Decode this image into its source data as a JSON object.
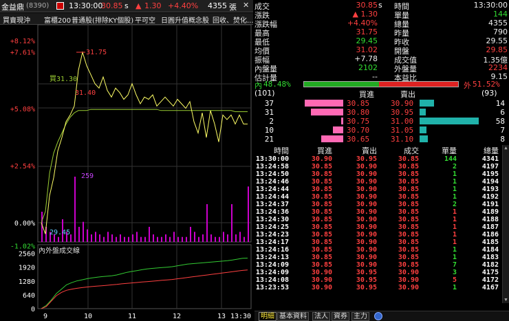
{
  "header": {
    "stock_name": "金益鼎",
    "stock_code": "(8390)",
    "time": "13:30:00",
    "price": "30.85",
    "price_suffix": "s",
    "change": "1.30",
    "change_pct": "+4.40%",
    "volume": "4355",
    "volume_unit": "張",
    "icons": [
      "calendar-icon",
      "up-triangle-icon",
      "close-icon"
    ]
  },
  "subheader": {
    "items": [
      "買賣現沖",
      "富櫃200",
      "普通股(排除KY個股)",
      "平可空",
      "日圓升值概念股",
      "回收、焚化..."
    ]
  },
  "chart_data": {
    "type": "line",
    "y_ticks": [
      "+8.12%",
      "+7.61%",
      "+5.08%",
      "+2.54%",
      "0.00%",
      "-1.02%"
    ],
    "annotations": [
      {
        "text": "31.75",
        "x": 9.98,
        "y": 31.75
      },
      {
        "text": "買31.30",
        "x": 9.8,
        "y": 31.3
      },
      {
        "text": "31.40",
        "x": 9.75,
        "y": 31.4
      },
      {
        "text": "259",
        "x": 9.75,
        "y": 259
      },
      {
        "text": "29.45",
        "x": 9.05,
        "y": 29.45
      }
    ],
    "lower_panel_title": "內外盤成交線",
    "lower_y_ticks": [
      "2560",
      "1920",
      "1280",
      "640",
      "0"
    ],
    "x_ticks": [
      "9",
      "10",
      "11",
      "12",
      "13",
      "13:30"
    ],
    "series": [
      {
        "values_pct": [
          0.0,
          -0.5,
          1.2,
          2.0,
          3.2,
          3.8,
          4.5,
          4.8,
          5.2,
          6.8,
          7.6,
          7.0,
          6.6,
          6.2,
          6.0,
          6.5,
          5.9,
          5.6,
          6.0,
          5.8,
          5.5,
          5.7,
          6.2,
          5.7,
          5.3,
          5.6,
          5.5,
          5.7,
          5.2,
          5.4,
          5.6,
          5.4,
          5.2,
          5.5,
          5.3,
          5.1,
          5.4,
          4.5,
          4.0,
          4.9,
          3.8,
          5.0,
          4.4,
          3.6,
          4.8,
          4.6,
          4.8,
          4.4,
          4.8,
          4.4,
          4.4
        ]
      },
      {
        "values_pct": [
          0.0,
          0.5,
          2.2,
          3.1,
          3.6,
          4.0,
          4.4,
          4.7,
          4.9,
          5.0,
          5.0,
          5.0,
          5.05,
          5.05,
          5.05,
          5.05,
          5.05,
          5.05,
          5.05,
          5.05,
          5.05,
          5.05,
          5.05,
          5.05,
          5.05,
          5.05,
          5.05,
          5.05,
          5.05,
          5.0,
          5.0,
          5.0,
          5.0,
          5.0,
          5.0,
          5.0,
          5.0,
          5.0,
          5.0,
          5.0,
          5.0,
          5.0,
          5.0,
          5.0,
          5.0,
          5.0,
          5.0,
          4.95,
          4.95,
          4.95,
          4.95
        ]
      },
      {
        "values": [
          120,
          60,
          40,
          30,
          20,
          90,
          40,
          30,
          259,
          60,
          80,
          50,
          30,
          40,
          30,
          20,
          40,
          30,
          20,
          30,
          20,
          20,
          30,
          40,
          20,
          20,
          60,
          30,
          20,
          20,
          30,
          20,
          40,
          20,
          20,
          20,
          60,
          40,
          20,
          30,
          150,
          30,
          20,
          20,
          40,
          30,
          150,
          30,
          40,
          20,
          220
        ]
      },
      {
        "name": "內盤",
        "values": [
          0,
          150,
          400,
          700,
          900,
          1100,
          1200,
          1280,
          1330,
          1380,
          1420,
          1450,
          1480,
          1500,
          1520,
          1560,
          1620,
          1680,
          1720,
          1760,
          1800,
          1840,
          1860,
          1880,
          1900,
          1920,
          1940,
          1980,
          2020,
          2060,
          2080,
          2100,
          2120,
          2140,
          2160,
          2180,
          2200,
          2220,
          2250,
          2290,
          2330,
          2340
        ]
      },
      {
        "name": "外盤",
        "values": [
          0,
          100,
          350,
          600,
          750,
          850,
          900,
          940,
          970,
          1000,
          1020,
          1040,
          1060,
          1080,
          1100,
          1120,
          1150,
          1170,
          1190,
          1210,
          1230,
          1250,
          1270,
          1290,
          1310,
          1330,
          1350,
          1380,
          1410,
          1440,
          1470,
          1500,
          1530,
          1560,
          1590,
          1620,
          1650,
          1680,
          1710,
          1740,
          1770,
          1790
        ]
      }
    ]
  },
  "quote": {
    "rows": [
      {
        "l1": "成交",
        "v1": "30.85",
        "v1s": "s",
        "c1": "red",
        "l2": "時間",
        "v2": "13:30:00",
        "c2": "wht"
      },
      {
        "l1": "漲跌",
        "v1": "▲ 1.30",
        "v1s": "",
        "c1": "red",
        "l2": "單量",
        "v2": "144",
        "c2": "grn"
      },
      {
        "l1": "漲跌幅",
        "v1": "+4.40%",
        "v1s": "",
        "c1": "red",
        "l2": "總量",
        "v2": "4355",
        "c2": "wht"
      },
      {
        "l1": "最高",
        "v1": "31.75",
        "v1s": "",
        "c1": "red",
        "l2": "昨量",
        "v2": "790",
        "c2": "wht"
      },
      {
        "l1": "最低",
        "v1": "29.45",
        "v1s": "",
        "c1": "grn",
        "l2": "昨收",
        "v2": "29.55",
        "c2": "wht"
      },
      {
        "l1": "均價",
        "v1": "31.02",
        "v1s": "",
        "c1": "red",
        "l2": "開盤",
        "v2": "29.85",
        "c2": "red"
      },
      {
        "l1": "振幅",
        "v1": "+7.78",
        "v1s": "",
        "c1": "wht",
        "l2": "成交值",
        "v2": "1.35億",
        "c2": "wht"
      },
      {
        "l1": "內盤量",
        "v1": "2102",
        "v1s": "",
        "c1": "grn",
        "l2": "外盤量",
        "v2": "2234",
        "c2": "red"
      },
      {
        "l1": "估計量",
        "v1": "--",
        "v1s": "",
        "c1": "wht",
        "l2": "本益比",
        "v2": "9.15",
        "c2": "wht"
      }
    ]
  },
  "ratio": {
    "inner_label": "內",
    "inner_pct": "48.48%",
    "outer_label": "外",
    "outer_pct": "51.52%",
    "inner_fraction": 0.4848
  },
  "orderbook": {
    "bid_total": "(101)",
    "ask_total": "(93)",
    "bid_header": "買進",
    "ask_header": "賣出",
    "rows": [
      {
        "bid_qty": "37",
        "bid_px": "30.85",
        "ask_px": "30.90",
        "ask_qty": "14",
        "bid_ratio": 1.0,
        "ask_ratio": 0.24
      },
      {
        "bid_qty": "31",
        "bid_px": "30.80",
        "ask_px": "30.95",
        "ask_qty": "6",
        "bid_ratio": 0.84,
        "ask_ratio": 0.1
      },
      {
        "bid_qty": "2",
        "bid_px": "30.75",
        "ask_px": "31.00",
        "ask_qty": "58",
        "bid_ratio": 0.06,
        "ask_ratio": 1.0
      },
      {
        "bid_qty": "10",
        "bid_px": "30.70",
        "ask_px": "31.05",
        "ask_qty": "7",
        "bid_ratio": 0.27,
        "ask_ratio": 0.12
      },
      {
        "bid_qty": "21",
        "bid_px": "30.65",
        "ask_px": "31.10",
        "ask_qty": "8",
        "bid_ratio": 0.57,
        "ask_ratio": 0.14
      }
    ]
  },
  "ticks": {
    "headers": [
      "時間",
      "買進",
      "賣出",
      "成交",
      "單量",
      "總量"
    ],
    "rows": [
      [
        "13:30:00",
        "30.90",
        "30.95",
        "30.85",
        "144",
        "4341"
      ],
      [
        "13:24:58",
        "30.85",
        "30.90",
        "30.85",
        "2",
        "4197"
      ],
      [
        "13:24:50",
        "30.85",
        "30.90",
        "30.85",
        "1",
        "4195"
      ],
      [
        "13:24:46",
        "30.85",
        "30.90",
        "30.85",
        "1",
        "4194"
      ],
      [
        "13:24:44",
        "30.85",
        "30.90",
        "30.85",
        "1",
        "4193"
      ],
      [
        "13:24:44",
        "30.85",
        "30.90",
        "30.85",
        "1",
        "4192"
      ],
      [
        "13:24:37",
        "30.85",
        "30.90",
        "30.85",
        "2",
        "4191"
      ],
      [
        "13:24:36",
        "30.85",
        "30.90",
        "30.85",
        "1",
        "4189"
      ],
      [
        "13:24:30",
        "30.85",
        "30.90",
        "30.85",
        "1",
        "4188"
      ],
      [
        "13:24:25",
        "30.85",
        "30.90",
        "30.85",
        "1",
        "4187"
      ],
      [
        "13:24:23",
        "30.85",
        "30.90",
        "30.85",
        "1",
        "4186"
      ],
      [
        "13:24:17",
        "30.85",
        "30.90",
        "30.85",
        "1",
        "4185"
      ],
      [
        "13:24:16",
        "30.85",
        "30.90",
        "30.85",
        "1",
        "4184"
      ],
      [
        "13:24:13",
        "30.85",
        "30.90",
        "30.85",
        "1",
        "4183"
      ],
      [
        "13:24:09",
        "30.85",
        "30.90",
        "30.85",
        "7",
        "4182"
      ],
      [
        "13:24:09",
        "30.90",
        "30.95",
        "30.90",
        "3",
        "4175"
      ],
      [
        "13:24:08",
        "30.90",
        "30.95",
        "30.90",
        "5",
        "4172"
      ],
      [
        "13:23:53",
        "30.90",
        "30.95",
        "30.90",
        "1",
        "4167"
      ]
    ],
    "qty_colors": [
      "grn",
      "grn",
      "grn",
      "grn",
      "grn",
      "grn",
      "grn",
      "red",
      "red",
      "red",
      "red",
      "red",
      "grn",
      "grn",
      "grn",
      "grn",
      "red",
      "grn"
    ]
  },
  "tabs": {
    "items": [
      "明細",
      "基本資料",
      "法人",
      "資券",
      "主力"
    ],
    "active": 0
  }
}
